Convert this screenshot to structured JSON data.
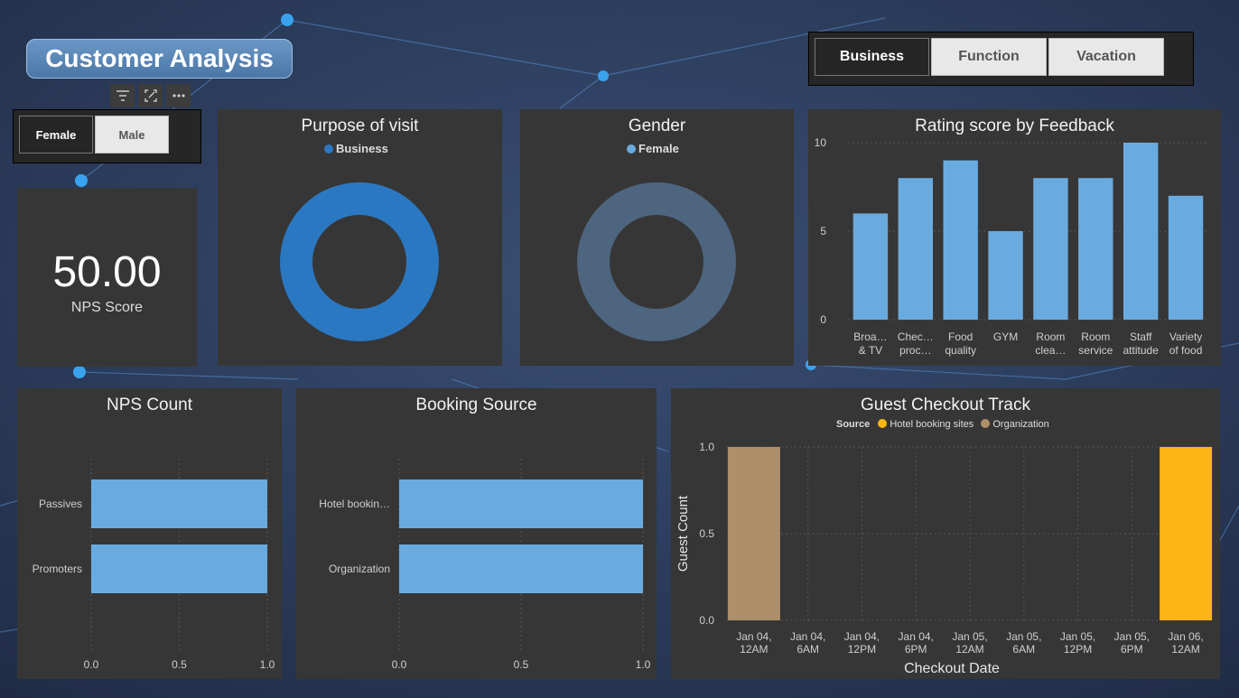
{
  "title": "Customer Analysis",
  "visual_header_icons": [
    "filter-icon",
    "focus-mode-icon",
    "more-options-icon"
  ],
  "purpose_slicer": {
    "options": [
      "Business",
      "Function",
      "Vacation"
    ],
    "selected": "Business"
  },
  "gender_slicer": {
    "options": [
      "Female",
      "Male"
    ],
    "selected": "Female"
  },
  "nps_card": {
    "value": "50.00",
    "label": "NPS Score"
  },
  "colors": {
    "bar": "#6aabdf",
    "donut_purpose": "#2b78c2",
    "donut_gender": "#4e6580",
    "hotel_booking_sites": "#fbb516",
    "organization": "#ad8f6a",
    "panel_bg": "#363636"
  },
  "purpose_donut": {
    "title": "Purpose of visit",
    "legend": "Business"
  },
  "gender_donut": {
    "title": "Gender",
    "legend": "Female"
  },
  "chart_data": [
    {
      "id": "rating",
      "type": "bar",
      "title": "Rating score by Feedback",
      "categories": [
        [
          "Broa…",
          "& TV"
        ],
        [
          "Chec…",
          "proc…"
        ],
        [
          "Food",
          "quality"
        ],
        [
          "GYM"
        ],
        [
          "Room",
          "clea…"
        ],
        [
          "Room",
          "service"
        ],
        [
          "Staff",
          "attitude"
        ],
        [
          "Variety",
          "of food"
        ]
      ],
      "values": [
        6,
        8,
        9,
        5,
        8,
        8,
        10,
        7
      ],
      "yticks": [
        "0",
        "5",
        "10"
      ],
      "ylim": [
        0,
        10
      ]
    },
    {
      "id": "nps_count",
      "type": "bar",
      "orientation": "horizontal",
      "title": "NPS Count",
      "categories": [
        "Passives",
        "Promoters"
      ],
      "values": [
        1,
        1
      ],
      "xticks": [
        "0.0",
        "0.5",
        "1.0"
      ],
      "xlim": [
        0,
        1
      ]
    },
    {
      "id": "booking",
      "type": "bar",
      "orientation": "horizontal",
      "title": "Booking Source",
      "categories": [
        "Hotel bookin…",
        "Organization"
      ],
      "values": [
        1,
        1
      ],
      "xticks": [
        "0.0",
        "0.5",
        "1.0"
      ],
      "xlim": [
        0,
        1
      ]
    },
    {
      "id": "checkout",
      "type": "bar",
      "title": "Guest Checkout Track",
      "legend_title": "Source",
      "series": [
        {
          "name": "Hotel booking sites",
          "x_index": 8,
          "value": 1.0
        },
        {
          "name": "Organization",
          "x_index": 0,
          "value": 1.0
        }
      ],
      "categories": [
        [
          "Jan 04,",
          "12AM"
        ],
        [
          "Jan 04,",
          "6AM"
        ],
        [
          "Jan 04,",
          "12PM"
        ],
        [
          "Jan 04,",
          "6PM"
        ],
        [
          "Jan 05,",
          "12AM"
        ],
        [
          "Jan 05,",
          "6AM"
        ],
        [
          "Jan 05,",
          "12PM"
        ],
        [
          "Jan 05,",
          "6PM"
        ],
        [
          "Jan 06,",
          "12AM"
        ]
      ],
      "yticks": [
        "0.0",
        "0.5",
        "1.0"
      ],
      "ylim": [
        0,
        1
      ],
      "xlabel": "Checkout Date",
      "ylabel": "Guest Count"
    }
  ]
}
